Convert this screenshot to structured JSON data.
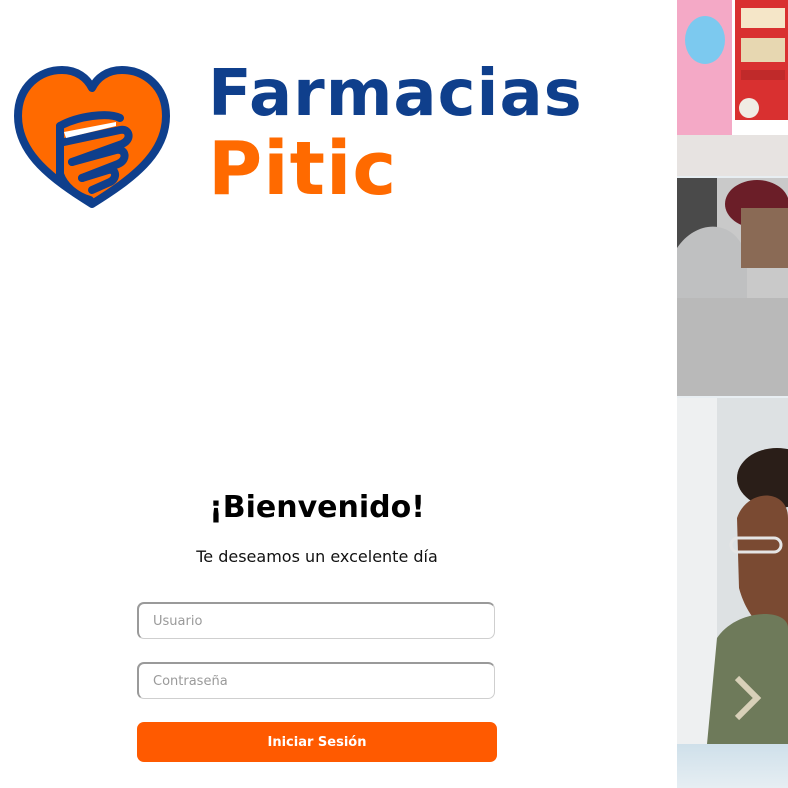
{
  "brand": {
    "line1": "Farmacias",
    "line2": "Pitic",
    "colors": {
      "blue": "#0f3f8c",
      "orange": "#ff6a00"
    }
  },
  "login": {
    "title": "¡Bienvenido!",
    "subtitle": "Te deseamos un excelente día",
    "username_placeholder": "Usuario",
    "password_placeholder": "Contraseña",
    "submit_label": "Iniciar Sesión",
    "accent": "#ff5a00"
  },
  "side_images": [
    "children-playroom-photo",
    "person-with-hat-photo",
    "woman-with-glasses-photo",
    "sky-photo"
  ]
}
